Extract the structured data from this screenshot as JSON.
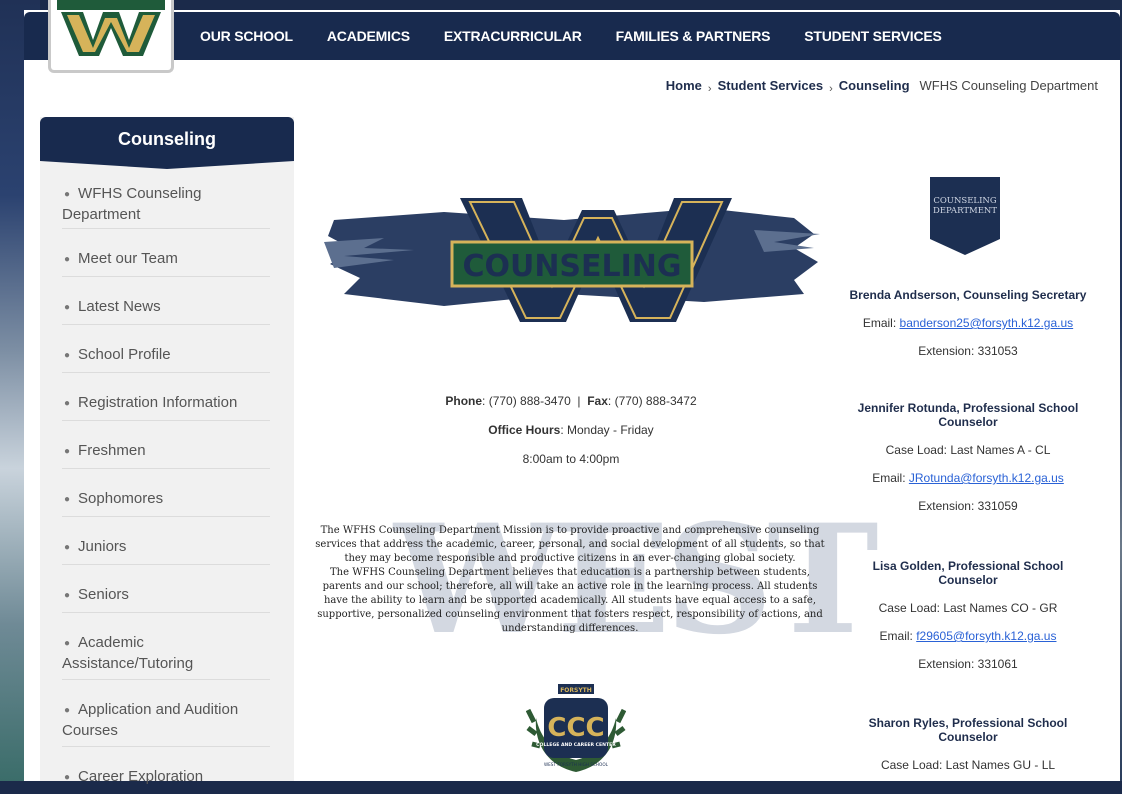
{
  "nav": {
    "items": [
      "OUR SCHOOL",
      "ACADEMICS",
      "EXTRACURRICULAR",
      "FAMILIES & PARTNERS",
      "STUDENT SERVICES"
    ]
  },
  "breadcrumb": {
    "items": [
      "Home",
      "Student Services",
      "Counseling"
    ],
    "current": "WFHS Counseling Department"
  },
  "sidebar": {
    "title": "Counseling",
    "items": [
      "WFHS Counseling Department",
      "Meet our Team",
      "Latest News",
      "School Profile",
      "Registration Information",
      "Freshmen",
      "Sophomores",
      "Juniors",
      "Seniors",
      "Academic Assistance/Tutoring",
      "Application and Audition Courses",
      "Career Exploration"
    ]
  },
  "banner": {
    "text": "COUNSELING",
    "letter": "W"
  },
  "contact": {
    "phone_label": "Phone",
    "phone": ": (770) 888-3470  |  ",
    "fax_label": "Fax",
    "fax": ": (770) 888-3472",
    "hours_label": "Office Hours",
    "hours_days": ": Monday - Friday",
    "hours_time": "8:00am to 4:00pm"
  },
  "mission": {
    "watermark": "WEST",
    "paragraph1": "The WFHS Counseling Department Mission is to provide proactive and comprehensive counseling services that address the academic, career, personal, and social development of all students, so that they may become responsible and productive citizens in an ever-changing global society.",
    "paragraph2": "The WFHS Counseling Department believes that education is a partnership between students, parents and our school; therefore, all will take an active role in the learning process. All students have the ability to learn and be supported academically. All students have equal access to a safe, supportive, personalized counseling environment that fosters respect, responsibility of actions, and understanding differences."
  },
  "ccc_logo": {
    "letters": "CCC",
    "ring": "COLLEGE AND CAREER CENTER",
    "school": "WEST FORSYTH HIGH SCHOOL",
    "top": "FORSYTH"
  },
  "dept_badge": {
    "line1": "COUNSELING",
    "line2": "DEPARTMENT"
  },
  "staff": [
    {
      "name": "Brenda Andserson, Counseling Secretary",
      "caseload": "",
      "email_label": "Email: ",
      "email": "banderson25@forsyth.k12.ga.us",
      "extension": "Extension: 331053"
    },
    {
      "name": "Jennifer Rotunda, Professional School Counselor",
      "caseload": "Case Load: Last Names A - CL",
      "email_label": "Email: ",
      "email": "JRotunda@forsyth.k12.ga.us",
      "extension": "Extension: 331059"
    },
    {
      "name": "Lisa Golden, Professional School Counselor",
      "caseload": "Case Load: Last Names CO - GR",
      "email_label": "Email: ",
      "email": "f29605@forsyth.k12.ga.us",
      "extension": "Extension: 331061"
    },
    {
      "name": "Sharon Ryles, Professional School Counselor",
      "caseload": "Case Load: Last Names GU - LL"
    }
  ],
  "colors": {
    "navy": "#182a4e",
    "gold": "#d6b35a",
    "green": "#1f5b3a",
    "link": "#2a62d6"
  }
}
